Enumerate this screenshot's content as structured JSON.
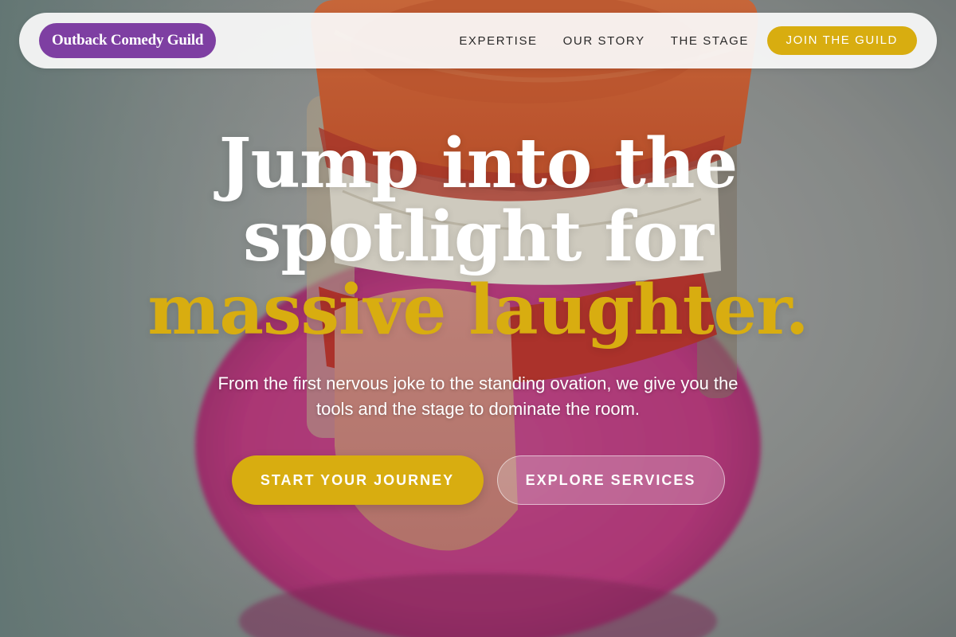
{
  "nav": {
    "brand": "Outback Comedy Guild",
    "links": [
      "EXPERTISE",
      "OUR STORY",
      "THE STAGE"
    ],
    "cta": "JOIN THE GUILD"
  },
  "hero": {
    "headline_line1": "Jump into the",
    "headline_line2": "spotlight for",
    "headline_accent": "massive laughter.",
    "subtext": "From the first nervous joke to the standing ovation, we give you the tools and the stage to dominate the room.",
    "primary_cta": "START YOUR JOURNEY",
    "secondary_cta": "EXPLORE SERVICES",
    "background_image": "chattering-teeth-toy-photo"
  },
  "colors": {
    "brand_purple": "#7e3fa2",
    "accent_gold": "#d8ad10",
    "nav_background": "#fafafa"
  }
}
